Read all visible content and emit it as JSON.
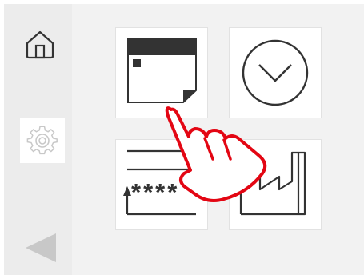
{
  "sidebar": {
    "items": [
      {
        "icon": "home-icon"
      },
      {
        "icon": "gear-icon"
      },
      {
        "icon": "back-arrow-icon"
      }
    ]
  },
  "tiles": [
    {
      "icon": "window-note-icon"
    },
    {
      "icon": "chevron-circle-icon"
    },
    {
      "icon": "password-entry-icon",
      "text": "****"
    },
    {
      "icon": "factory-icon"
    }
  ],
  "overlay": {
    "icon": "tap-hand-icon",
    "color": "#e30613"
  },
  "colors": {
    "icon": "#333333",
    "panel": "#f2f2f2",
    "sidebar": "#ececec",
    "muted": "#c8c8c8"
  }
}
